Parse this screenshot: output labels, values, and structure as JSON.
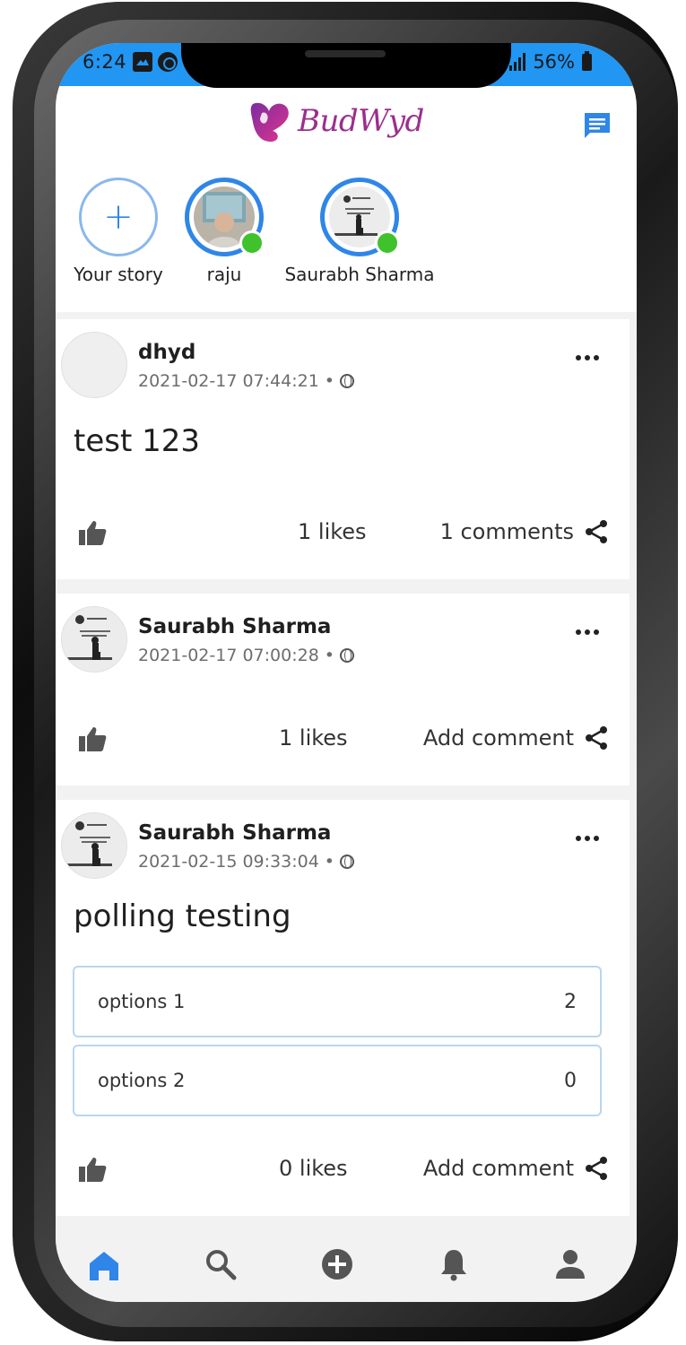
{
  "status_bar": {
    "time": "6:24",
    "battery": "56%"
  },
  "app": {
    "logo_text": "BudWyd"
  },
  "stories": [
    {
      "label": "Your story",
      "type": "add",
      "add_symbol": "+"
    },
    {
      "label": "raju",
      "online": true
    },
    {
      "label": "Saurabh Sharma",
      "online": true
    }
  ],
  "posts": [
    {
      "author": "dhyd",
      "timestamp": "2021-02-17 07:44:21",
      "text": "test 123",
      "likes": "1 likes",
      "comments": "1 comments"
    },
    {
      "author": "Saurabh Sharma",
      "timestamp": "2021-02-17 07:00:28",
      "text": "",
      "likes": "1 likes",
      "comments": "Add comment"
    },
    {
      "author": "Saurabh Sharma",
      "timestamp": "2021-02-15 09:33:04",
      "text": "polling testing",
      "likes": "0 likes",
      "comments": "Add comment",
      "poll": [
        {
          "label": "options 1",
          "count": "2"
        },
        {
          "label": "options 2",
          "count": "0"
        }
      ]
    }
  ],
  "meta_separator": "•",
  "tabs": [
    "home-icon",
    "search-icon",
    "add-post-icon",
    "notifications-icon",
    "profile-icon"
  ],
  "colors": {
    "primary": "#2196f3",
    "accent_blue": "#2f86e8",
    "online": "#3fc22c",
    "brand": "#9c2e8e"
  }
}
